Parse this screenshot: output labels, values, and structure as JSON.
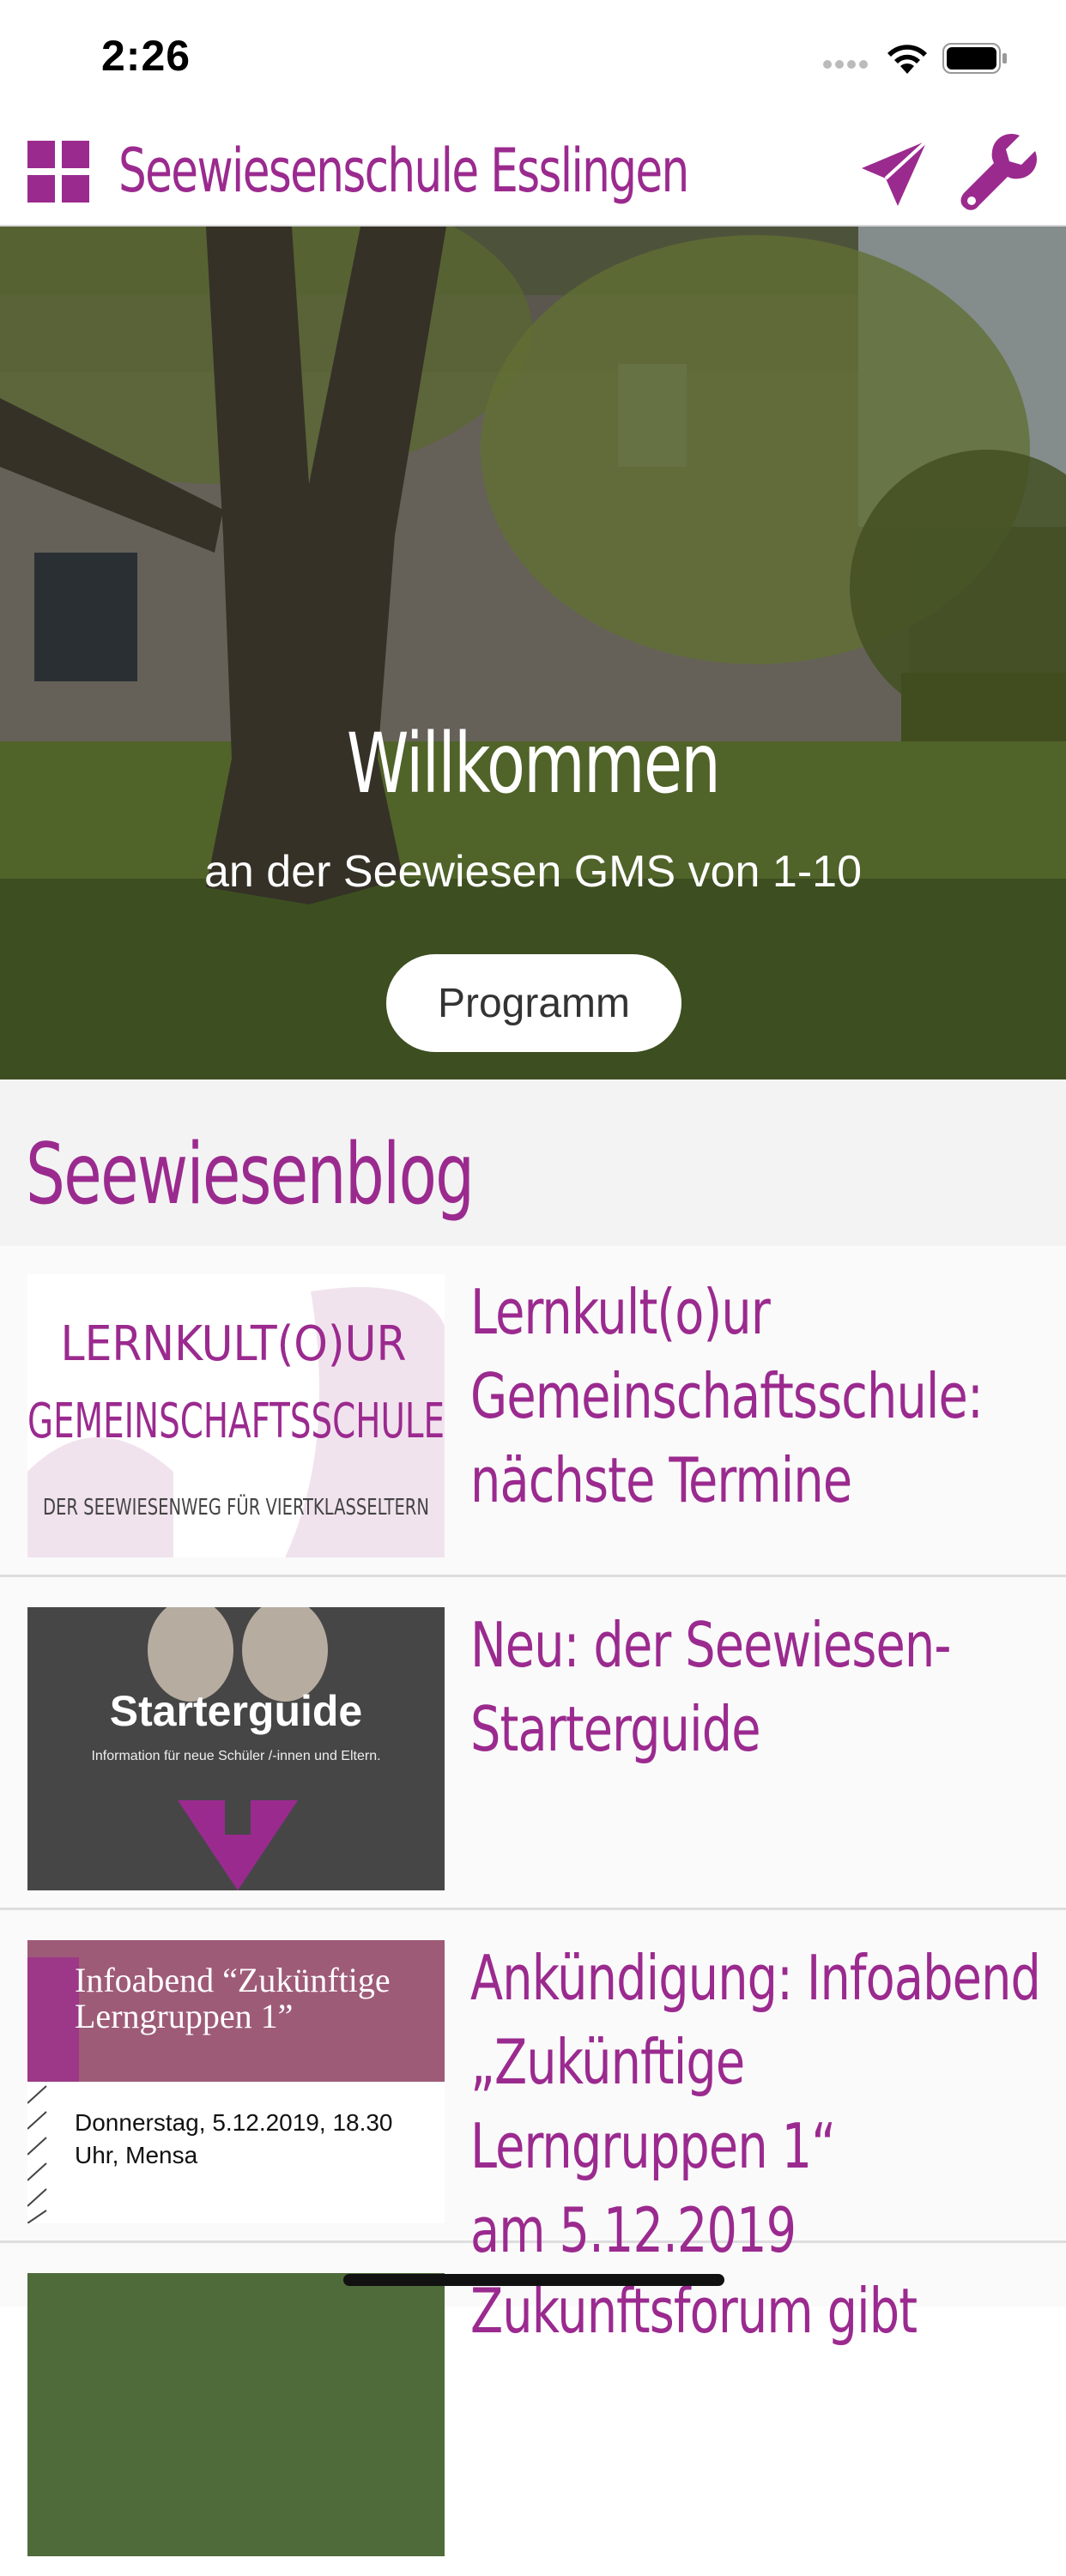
{
  "status_bar": {
    "time": "2:26"
  },
  "header": {
    "title": "Seewiesenschule Esslingen",
    "menu_icon": "grid-icon",
    "send_icon": "paper-plane-icon",
    "settings_icon": "wrench-icon",
    "accent_color": "#9b2a8f"
  },
  "hero": {
    "title": "Willkommen",
    "subtitle": "an der Seewiesen GMS von 1-10",
    "button_label": "Programm",
    "slide_count": 4,
    "active_slide": 1
  },
  "blog": {
    "heading": "Seewiesenblog",
    "posts": [
      {
        "title_lines": [
          "Lernkult(o)ur",
          "Gemeinschaftsschule:",
          "nächste Termine"
        ],
        "thumb": {
          "line1": "LERNKULT(O)UR",
          "line2": "GEMEINSCHAFTSSCHULE",
          "line3": "DER SEEWIESENWEG FÜR VIERTKLASSELTERN"
        }
      },
      {
        "title_lines": [
          "Neu: der Seewiesen-",
          "Starterguide"
        ],
        "thumb": {
          "title": "Starterguide",
          "subtitle": "Information für neue Schüler /-innen und Eltern."
        }
      },
      {
        "title_lines": [
          "Ankündigung: Infoabend",
          "„Zukünftige Lerngruppen 1“",
          "am 5.12.2019"
        ],
        "thumb": {
          "title_line1": "Infoabend “Zukünftige",
          "title_line2": "Lerngruppen 1”",
          "date_line1": "Donnerstag, 5.12.2019, 18.30",
          "date_line2": "Uhr, Mensa"
        }
      },
      {
        "title_lines": [
          "Zukunftsforum gibt"
        ]
      }
    ]
  }
}
